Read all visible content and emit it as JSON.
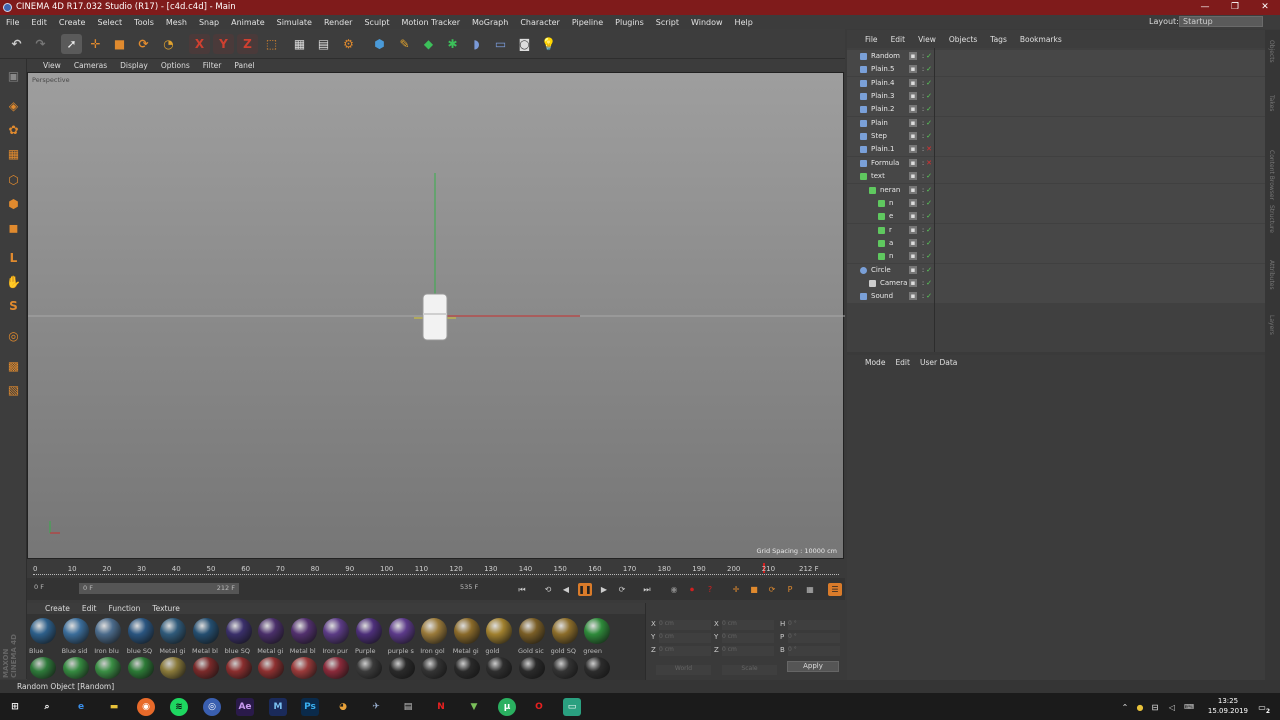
{
  "window": {
    "title": "CINEMA 4D R17.032 Studio (R17) - [c4d.c4d] - Main",
    "controls": [
      "—",
      "❐",
      "✕"
    ]
  },
  "menubar": [
    "File",
    "Edit",
    "Create",
    "Select",
    "Tools",
    "Mesh",
    "Snap",
    "Animate",
    "Simulate",
    "Render",
    "Sculpt",
    "Motion Tracker",
    "MoGraph",
    "Character",
    "Pipeline",
    "Plugins",
    "Script",
    "Window",
    "Help"
  ],
  "layout": {
    "label": "Layout:",
    "value": "Startup"
  },
  "viewport": {
    "menu": [
      "View",
      "Cameras",
      "Display",
      "Options",
      "Filter",
      "Panel"
    ],
    "label": "Perspective",
    "grid_spacing": "Grid Spacing : 10000 cm"
  },
  "timeline": {
    "ticks": [
      "0",
      "10",
      "20",
      "30",
      "40",
      "50",
      "60",
      "70",
      "80",
      "90",
      "100",
      "110",
      "120",
      "130",
      "140",
      "150",
      "160",
      "170",
      "180",
      "190",
      "200",
      "210"
    ],
    "end_label": "212 F",
    "current_frame": "0 F",
    "range_start": "0 F",
    "range_end": "212 F",
    "total_frames": "535 F"
  },
  "material_menu": [
    "Create",
    "Edit",
    "Function",
    "Texture"
  ],
  "materials_row1": [
    {
      "label": "Blue",
      "color": "#2d5f8a"
    },
    {
      "label": "Blue sid",
      "color": "#3b6d9a"
    },
    {
      "label": "Iron blu",
      "color": "#4b6b8b"
    },
    {
      "label": "blue SQ",
      "color": "#2a5580"
    },
    {
      "label": "Metal gi",
      "color": "#2f5a7a"
    },
    {
      "label": "Metal bl",
      "color": "#244e70"
    },
    {
      "label": "blue SQ",
      "color": "#3a2f6a"
    },
    {
      "label": "Metal gi",
      "color": "#4a2f6a"
    },
    {
      "label": "Metal bl",
      "color": "#52306e"
    },
    {
      "label": "Iron pur",
      "color": "#5b3b85"
    },
    {
      "label": "Purple",
      "color": "#4d2f7a"
    },
    {
      "label": "purple s",
      "color": "#5c3a8a"
    },
    {
      "label": "Iron gol",
      "color": "#9a7a3a"
    },
    {
      "label": "Metal gi",
      "color": "#8a6a2a"
    },
    {
      "label": "gold",
      "color": "#a0802e"
    },
    {
      "label": "Gold sic",
      "color": "#7a5e26"
    },
    {
      "label": "gold SQ",
      "color": "#8c6d2a"
    },
    {
      "label": "green",
      "color": "#2e8a3a"
    }
  ],
  "materials_row2": [
    "#2e7a3a",
    "#358a40",
    "#3a8e44",
    "#2c7a36",
    "#8a7a3a",
    "#7a2a2a",
    "#8a2e2e",
    "#8e3030",
    "#9a3a3a",
    "#8a2a3a",
    "#3a3a3a",
    "#2a2a2a",
    "#333333",
    "#2a2a2a",
    "#2e2e2e",
    "#2a2a2a",
    "#333333",
    "#2c2c2c"
  ],
  "coordinates": {
    "rows": [
      {
        "a": "X",
        "av": "0 cm",
        "b": "X",
        "bv": "0 cm",
        "c": "H",
        "cv": "0 °"
      },
      {
        "a": "Y",
        "av": "0 cm",
        "b": "Y",
        "bv": "0 cm",
        "c": "P",
        "cv": "0 °"
      },
      {
        "a": "Z",
        "av": "0 cm",
        "b": "Z",
        "bv": "0 cm",
        "c": "B",
        "cv": "0 °"
      }
    ],
    "mode1": "World",
    "mode2": "Scale",
    "apply": "Apply"
  },
  "object_manager": {
    "menu": [
      "File",
      "Edit",
      "View",
      "Objects",
      "Tags",
      "Bookmarks"
    ],
    "objects": [
      {
        "name": "Random",
        "indent": 0,
        "icon": "#7aa0d8",
        "type": "effector"
      },
      {
        "name": "Plain.5",
        "indent": 0,
        "icon": "#7aa0d8",
        "type": "effector"
      },
      {
        "name": "Plain.4",
        "indent": 0,
        "icon": "#7aa0d8",
        "type": "effector"
      },
      {
        "name": "Plain.3",
        "indent": 0,
        "icon": "#7aa0d8",
        "type": "effector"
      },
      {
        "name": "Plain.2",
        "indent": 0,
        "icon": "#7aa0d8",
        "type": "effector"
      },
      {
        "name": "Plain",
        "indent": 0,
        "icon": "#7aa0d8",
        "type": "effector"
      },
      {
        "name": "Step",
        "indent": 0,
        "icon": "#7aa0d8",
        "type": "effector"
      },
      {
        "name": "Plain.1",
        "indent": 0,
        "icon": "#7aa0d8",
        "type": "effector",
        "off": true
      },
      {
        "name": "Formula",
        "indent": 0,
        "icon": "#7aa0d8",
        "type": "effector",
        "off": true
      },
      {
        "name": "text",
        "indent": 0,
        "icon": "#5fc85f",
        "type": "mograph"
      },
      {
        "name": "neran",
        "indent": 1,
        "icon": "#5fc85f",
        "type": "mograph"
      },
      {
        "name": "n",
        "indent": 2,
        "icon": "#5fc85f",
        "type": "mograph"
      },
      {
        "name": "e",
        "indent": 2,
        "icon": "#5fc85f",
        "type": "mograph"
      },
      {
        "name": "r",
        "indent": 2,
        "icon": "#5fc85f",
        "type": "mograph"
      },
      {
        "name": "a",
        "indent": 2,
        "icon": "#5fc85f",
        "type": "mograph"
      },
      {
        "name": "n",
        "indent": 2,
        "icon": "#5fc85f",
        "type": "mograph"
      },
      {
        "name": "Circle",
        "indent": 0,
        "icon": "#7aa0d8",
        "type": "spline"
      },
      {
        "name": "Camera",
        "indent": 1,
        "icon": "#cccccc",
        "type": "camera"
      },
      {
        "name": "Sound",
        "indent": 0,
        "icon": "#7aa0d8",
        "type": "sound"
      }
    ]
  },
  "attributes": {
    "menu": [
      "Mode",
      "Edit",
      "User Data"
    ]
  },
  "side_tabs": [
    "Objects",
    "Takes",
    "Content Browser",
    "Structure",
    "Attributes",
    "Layers"
  ],
  "statusbar": "Random Object [Random]",
  "taskbar": {
    "time": "13:25",
    "date": "15.09.2019",
    "notification_count": "2"
  },
  "colors": {
    "titlebar": "#7f1b1b",
    "accent": "#d97b2a",
    "x_axis": "#c8302e",
    "y_axis": "#36b04a"
  }
}
